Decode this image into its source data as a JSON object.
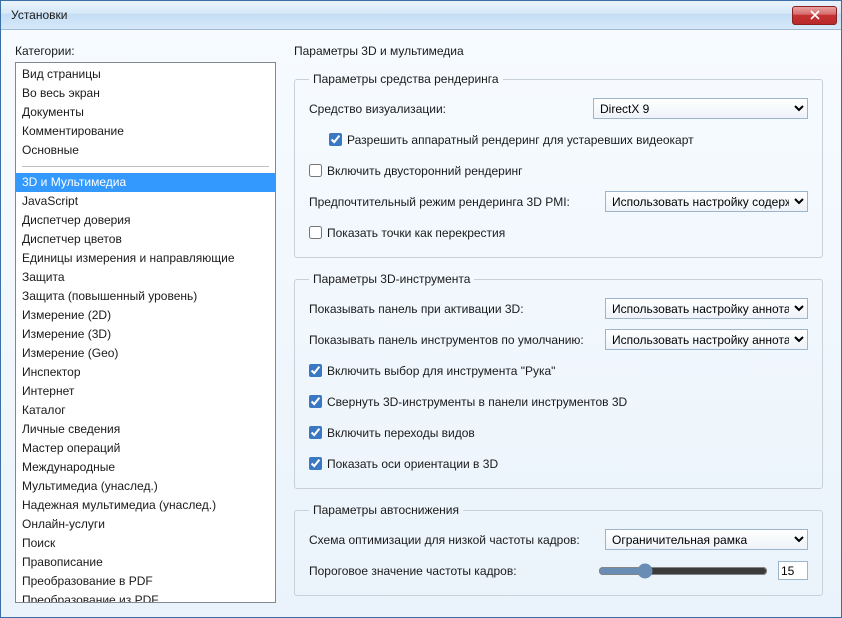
{
  "window": {
    "title": "Установки"
  },
  "categories": {
    "label": "Категории:",
    "group1": [
      "Вид страницы",
      "Во весь экран",
      "Документы",
      "Комментирование",
      "Основные"
    ],
    "group2": [
      "3D и Мультимедиа",
      "JavaScript",
      "Диспетчер доверия",
      "Диспетчер цветов",
      "Единицы измерения и направляющие",
      "Защита",
      "Защита (повышенный уровень)",
      "Измерение (2D)",
      "Измерение (3D)",
      "Измерение (Geo)",
      "Инспектор",
      "Интернет",
      "Каталог",
      "Личные сведения",
      "Мастер операций",
      "Международные",
      "Мультимедиа (унаслед.)",
      "Надежная мультимедиа (унаслед.)",
      "Онлайн-услуги",
      "Поиск",
      "Правописание",
      "Преобразование в PDF",
      "Преобразование из PDF"
    ],
    "selected": "3D и Мультимедиа"
  },
  "right": {
    "heading": "Параметры 3D и мультимедиа",
    "renderer": {
      "legend": "Параметры средства рендеринга",
      "visualizer_label": "Средство визуализации:",
      "visualizer_value": "DirectX 9",
      "hw_legacy_label": "Разрешить аппаратный рендеринг для устаревших видеокарт",
      "hw_legacy_checked": true,
      "doublesided_label": "Включить двусторонний рендеринг",
      "doublesided_checked": false,
      "pmi_label": "Предпочтительный режим рендеринга 3D PMI:",
      "pmi_value": "Использовать настройку содержимого",
      "crosshair_label": "Показать точки как перекрестия",
      "crosshair_checked": false
    },
    "tool": {
      "legend": "Параметры 3D-инструмента",
      "show_panel_label": "Показывать панель при активации 3D:",
      "show_panel_value": "Использовать настройку аннотаций",
      "default_toolbar_label": "Показывать панель инструментов по умолчанию:",
      "default_toolbar_value": "Использовать настройку аннотаций",
      "hand_select_label": "Включить выбор для инструмента \"Рука\"",
      "hand_select_checked": true,
      "collapse_3d_tools_label": "Свернуть 3D-инструменты в панели инструментов 3D",
      "collapse_3d_tools_checked": true,
      "view_transitions_label": "Включить переходы видов",
      "view_transitions_checked": true,
      "orientation_axes_label": "Показать оси ориентации в 3D",
      "orientation_axes_checked": true
    },
    "autodegrade": {
      "legend": "Параметры автоснижения",
      "scheme_label": "Схема оптимизации для низкой частоты кадров:",
      "scheme_value": "Ограничительная рамка",
      "threshold_label": "Пороговое значение частоты кадров:",
      "threshold_value": "15"
    }
  }
}
